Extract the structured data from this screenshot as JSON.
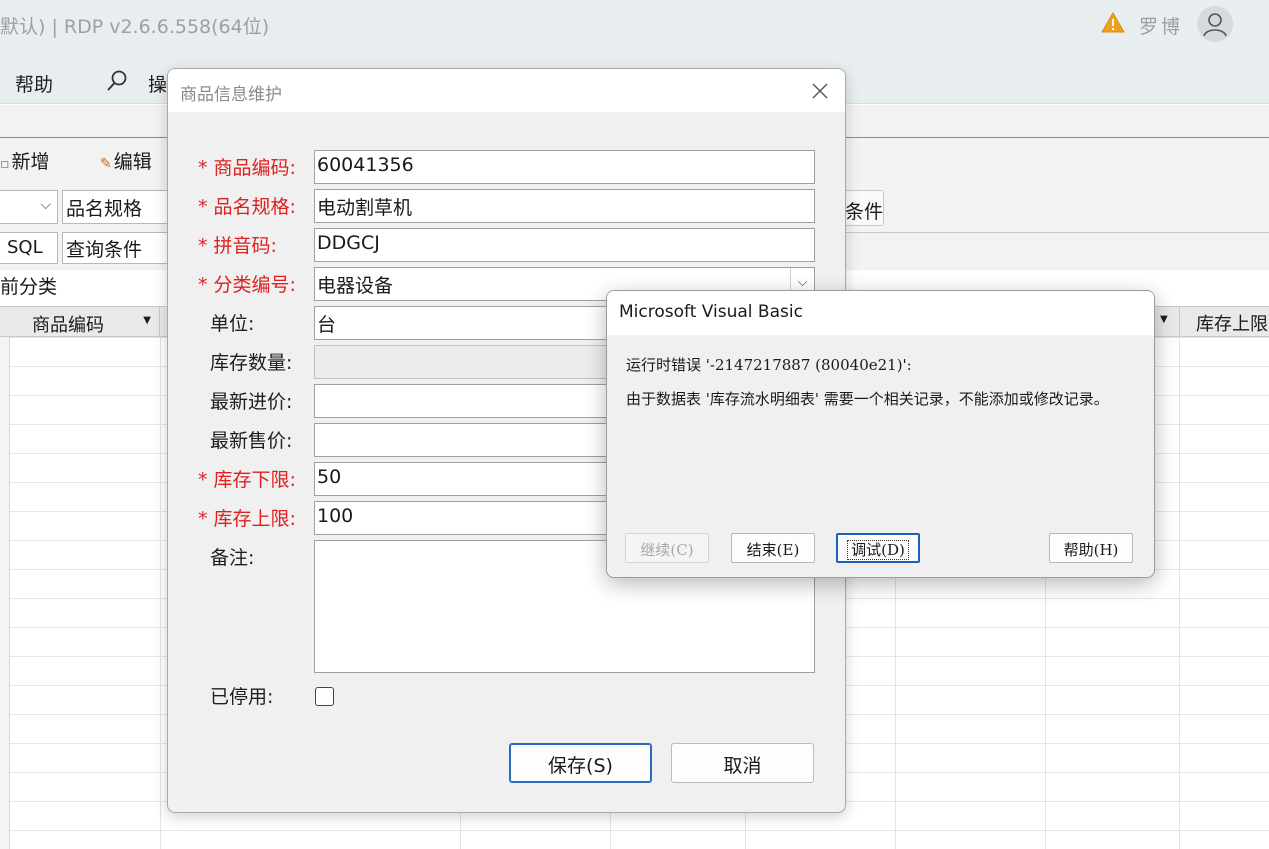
{
  "window": {
    "title": "默认) | RDP v2.6.6.558(64位)",
    "user": "罗博"
  },
  "menu": {
    "help": "帮助",
    "operate": "操"
  },
  "toolbar": {
    "new_label": "新增",
    "edit_label": "编辑",
    "spec_field": "品名规格",
    "condition_button": "条件",
    "sql_button": "SQL",
    "query_field": "查询条件",
    "category_label": "前分类"
  },
  "grid": {
    "col_code": "商品编码",
    "col_upper": "库存上限"
  },
  "goods_dialog": {
    "title": "商品信息维护",
    "fields": [
      {
        "label": "* 商品编码:",
        "value": "60041356"
      },
      {
        "label": "* 品名规格:",
        "value": "电动割草机"
      },
      {
        "label": "* 拼音码:",
        "value": "DDGCJ"
      },
      {
        "label": "* 分类编号:",
        "value": "电器设备"
      },
      {
        "label": "单位:",
        "value": "台"
      },
      {
        "label": "库存数量:",
        "value": ""
      },
      {
        "label": "最新进价:",
        "value": ""
      },
      {
        "label": "最新售价:",
        "value": ""
      },
      {
        "label": "* 库存下限:",
        "value": "50"
      },
      {
        "label": "* 库存上限:",
        "value": "100"
      }
    ],
    "remark_label": "备注:",
    "disabled_label": "已停用:",
    "save_button": "保存(S)",
    "cancel_button": "取消"
  },
  "vb_error": {
    "title": "Microsoft Visual Basic",
    "line1": "运行时错误 '-2147217887 (80040e21)':",
    "line2": "由于数据表 '库存流水明细表' 需要一个相关记录，不能添加或修改记录。",
    "continue_button": "继续(C)",
    "end_button": "结束(E)",
    "debug_button": "调试(D)",
    "help_button": "帮助(H)"
  },
  "colors": {
    "required_label": "#e02020",
    "focus_border": "#2a6bc0",
    "warning": "#f0a020"
  },
  "icons": [
    "warning-icon",
    "avatar-icon",
    "search-icon",
    "new-icon",
    "edit-icon",
    "close-icon",
    "chevron-down-icon"
  ]
}
